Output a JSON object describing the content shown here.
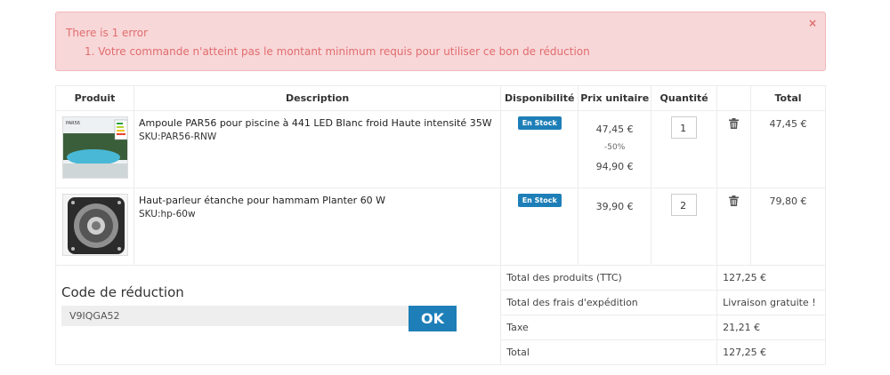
{
  "alert": {
    "title": "There is 1 error",
    "message": "1. Votre commande n'atteint pas le montant minimum requis pour utiliser ce bon de réduction",
    "close": "×"
  },
  "table": {
    "headers": {
      "product": "Produit",
      "description": "Description",
      "availability": "Disponibilité",
      "unit_price": "Prix unitaire",
      "quantity": "Quantité",
      "delete": "",
      "total": "Total"
    },
    "items": [
      {
        "name": "Ampoule PAR56 pour piscine à 441 LED Blanc froid Haute intensité 35W",
        "sku": "SKU:PAR56-RNW",
        "stock": "En Stock",
        "price": "47,45 €",
        "discount": "-50%",
        "old_price": "94,90 €",
        "quantity": "1",
        "total": "47,45 €",
        "thumb_label": "PAR56"
      },
      {
        "name": "Haut-parleur étanche pour hammam Planter 60 W",
        "sku": "SKU:hp-60w",
        "stock": "En Stock",
        "price": "39,90 €",
        "quantity": "2",
        "total": "79,80 €"
      }
    ]
  },
  "summary": {
    "products_label": "Total des produits (TTC)",
    "products_value": "127,25 €",
    "shipping_label": "Total des frais d'expédition",
    "shipping_value": "Livraison gratuite !",
    "tax_label": "Taxe",
    "tax_value": "21,21 €",
    "total_label": "Total",
    "total_value": "127,25 €"
  },
  "coupon": {
    "title": "Code de réduction",
    "value": "V9IQGA52",
    "button": "OK"
  },
  "colors": {
    "accent": "#1e7fb8",
    "alert_bg": "#f8d7d9",
    "alert_text": "#e06d6d"
  },
  "icons": {
    "delete": "trash-icon",
    "close": "close-icon"
  }
}
